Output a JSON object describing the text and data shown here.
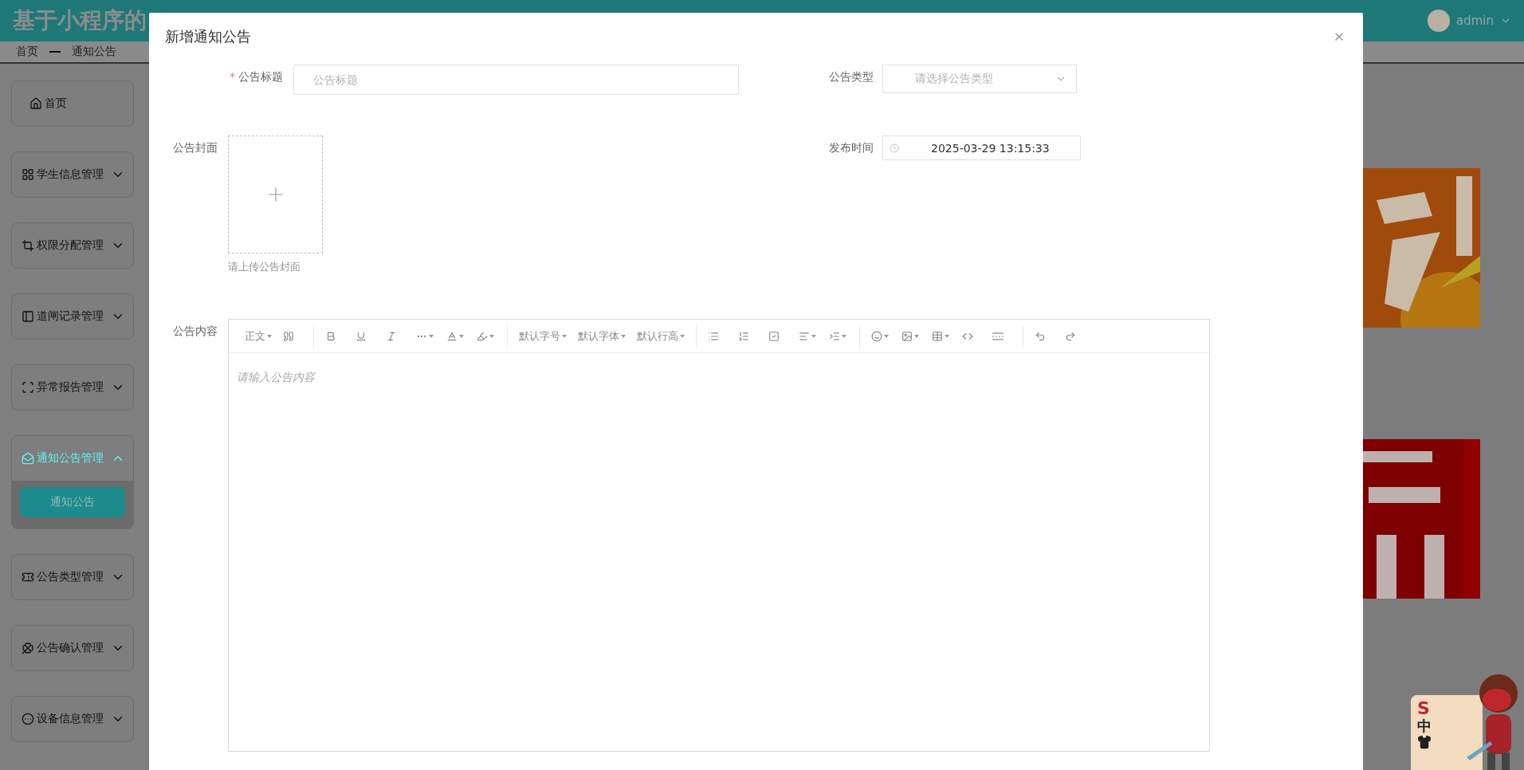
{
  "header": {
    "title": "基于小程序的",
    "user": "admin"
  },
  "breadcrumb": [
    "首页",
    "通知公告"
  ],
  "sidebar": {
    "items": [
      {
        "kind": "link",
        "label": "首页"
      },
      {
        "kind": "menu",
        "label": "学生信息管理",
        "expanded": false
      },
      {
        "kind": "menu",
        "label": "权限分配管理",
        "expanded": false
      },
      {
        "kind": "menu",
        "label": "道闸记录管理",
        "expanded": false
      },
      {
        "kind": "menu",
        "label": "异常报告管理",
        "expanded": false
      },
      {
        "kind": "menu",
        "label": "通知公告管理",
        "expanded": true,
        "children": [
          {
            "label": "通知公告",
            "selected": true
          }
        ]
      },
      {
        "kind": "menu",
        "label": "公告类型管理",
        "expanded": false
      },
      {
        "kind": "menu",
        "label": "公告确认管理",
        "expanded": false
      },
      {
        "kind": "menu",
        "label": "设备信息管理",
        "expanded": false
      }
    ]
  },
  "dialog": {
    "title": "新增通知公告",
    "title_field": {
      "required_mark": "*",
      "label": "公告标题",
      "placeholder": "公告标题"
    },
    "type_field": {
      "label": "公告类型",
      "placeholder": "请选择公告类型"
    },
    "cover": {
      "label": "公告封面",
      "hint": "请上传公告封面"
    },
    "publish_time": {
      "label": "发布时间",
      "value": "2025-03-29 13:15:33"
    },
    "content": {
      "label": "公告内容",
      "placeholder": "请输入公告内容",
      "toolbar_texts": [
        "正文",
        "默认字号",
        "默认字体",
        "默认行高"
      ]
    }
  },
  "ime_widget": {
    "logo": "S",
    "mode": "中"
  }
}
